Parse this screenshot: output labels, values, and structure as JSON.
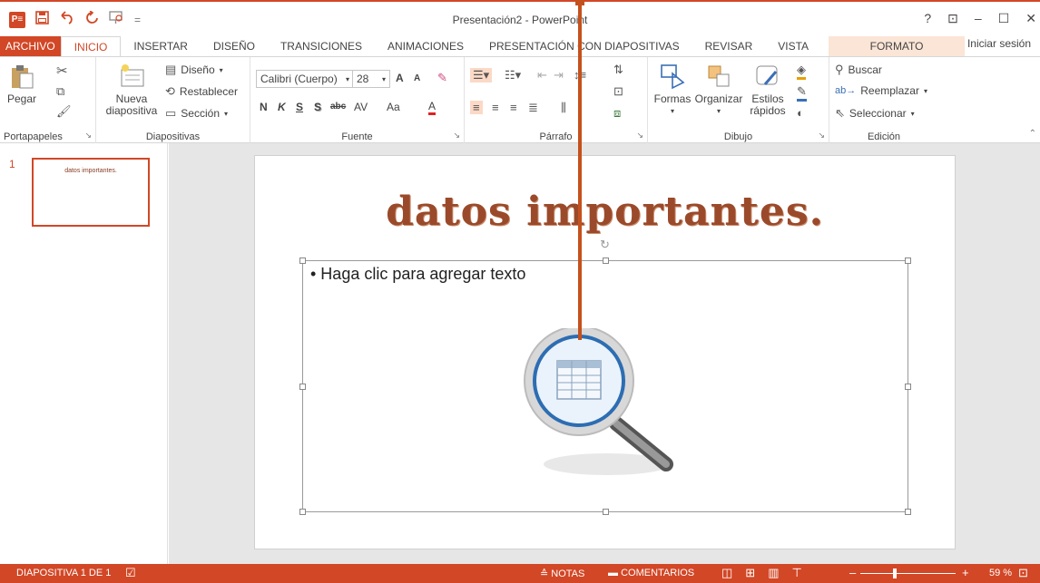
{
  "window": {
    "title": "Presentación2 - PowerPoint",
    "help": "?",
    "restore_ribbon": "⊡",
    "minimize": "–",
    "maximize": "☐",
    "close": "✕",
    "signin": "Iniciar sesión"
  },
  "qat": {
    "app_icon": "P≡",
    "save_icon": "save-icon",
    "undo_icon": "undo-icon",
    "redo_icon": "redo-icon",
    "present_icon": "start-presentation-icon",
    "customize": "="
  },
  "tabs": [
    {
      "label": "ARCHIVO"
    },
    {
      "label": "INICIO"
    },
    {
      "label": "INSERTAR"
    },
    {
      "label": "DISEÑO"
    },
    {
      "label": "TRANSICIONES"
    },
    {
      "label": "ANIMACIONES"
    },
    {
      "label": "PRESENTACIÓN CON DIAPOSITIVAS"
    },
    {
      "label": "REVISAR"
    },
    {
      "label": "VISTA"
    },
    {
      "label": "FORMATO"
    }
  ],
  "ribbon": {
    "portapapeles": {
      "label": "Portapapeles",
      "paste": "Pegar"
    },
    "diapositivas": {
      "label": "Diapositivas",
      "new_slide_1": "Nueva",
      "new_slide_2": "diapositiva",
      "layout": "Diseño",
      "reset": "Restablecer",
      "section": "Sección"
    },
    "fuente": {
      "label": "Fuente",
      "font_name": "Calibri (Cuerpo)",
      "font_size": "28",
      "grow": "A",
      "shrink": "A",
      "bold": "N",
      "italic": "K",
      "underline": "S",
      "shadow": "S",
      "strike": "abc",
      "spacing": "AV",
      "case": "Aa",
      "color": "A"
    },
    "parrafo": {
      "label": "Párrafo"
    },
    "dibujo": {
      "label": "Dibujo",
      "shapes": "Formas",
      "arrange": "Organizar",
      "styles_1": "Estilos",
      "styles_2": "rápidos"
    },
    "edicion": {
      "label": "Edición",
      "find": "Buscar",
      "replace": "Reemplazar",
      "select": "Seleccionar"
    }
  },
  "slides": [
    {
      "number": "1",
      "title": "datos importantes."
    }
  ],
  "slide": {
    "title": "datos importantes.",
    "placeholder": "• Haga clic para agregar texto"
  },
  "status": {
    "slide_count": "DIAPOSITIVA 1 DE 1",
    "notes": "≙ NOTAS",
    "comments": "COMENTARIOS",
    "zoom": "59 %"
  },
  "colors": {
    "accent": "#d24726",
    "title_text": "#9a4a2a"
  }
}
